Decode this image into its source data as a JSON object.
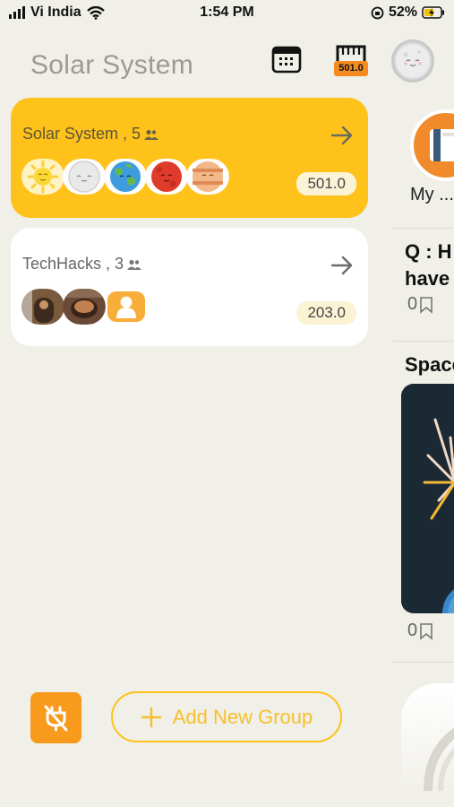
{
  "status_bar": {
    "carrier": "Vi India",
    "time": "1:54 PM",
    "battery": "52%"
  },
  "header": {
    "title": "Solar System",
    "meter_value": "501.0"
  },
  "groups": [
    {
      "name": "Solar System , 5",
      "score": "501.0",
      "members": [
        "sun-avatar",
        "moon-avatar",
        "earth-avatar",
        "mars-avatar",
        "jupiter-avatar"
      ]
    },
    {
      "name": "TechHacks , 3",
      "score": "203.0",
      "members": [
        "photo-avatar",
        "photo-avatar",
        "default-user-avatar"
      ]
    }
  ],
  "feed_peek": {
    "profile_label": "My ...",
    "question_line1": "Q : H",
    "question_line2": "have",
    "count1": "0",
    "space_title": "Space",
    "count2": "0"
  },
  "bottom": {
    "add_group_label": "Add New Group"
  },
  "colors": {
    "accent_yellow": "#fec21a",
    "accent_orange": "#f89a1c",
    "background": "#f0efe8"
  }
}
